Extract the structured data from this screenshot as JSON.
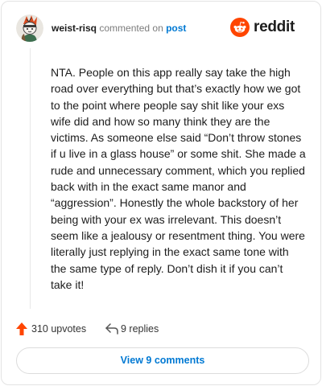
{
  "comment": {
    "username": "weist-risq",
    "commented_text": "commented on",
    "post_link": "post",
    "body": "NTA. People on this app really say take the high road over everything but that’s exactly how we got to the point where people say shit like your exs wife did and how so many think they are the victims. As someone else said “Don’t throw stones if u live in a glass house” or some shit. She made a rude and unnecessary comment, which you replied back with in the exact same manor and “aggression”. Honestly the whole backstory of her being with your ex was irrelevant. This doesn’t seem like a jealousy or resentment thing. You were literally just replying in the exact same tone with the same type of reply. Don’t dish it if you can’t take it!",
    "upvotes": "310 upvotes",
    "replies": "9 replies",
    "view_comments": "View 9 comments"
  },
  "brand": {
    "name": "reddit",
    "icon": "reddit-snoo-icon"
  },
  "icons": {
    "upvote": "upvote-arrow-icon",
    "reply": "reply-arrow-icon",
    "avatar": "user-avatar"
  },
  "colors": {
    "accent_blue": "#0079d3",
    "upvote_orange": "#ff4500",
    "brand_orange": "#ff4500"
  }
}
